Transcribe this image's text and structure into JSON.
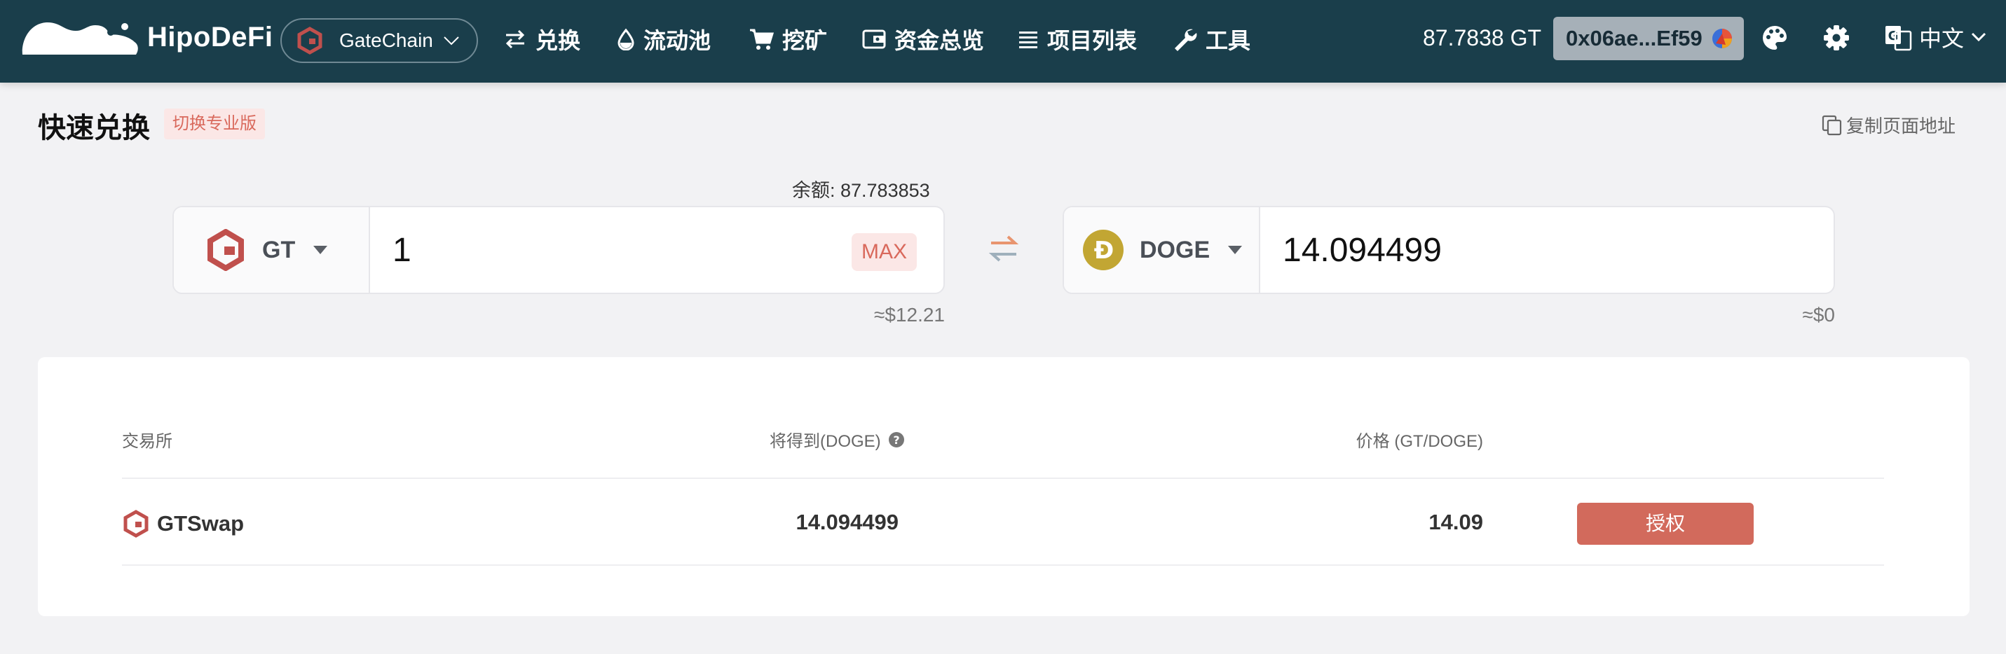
{
  "brand": {
    "name": "HipoDeFi"
  },
  "chain": {
    "name": "GateChain"
  },
  "nav": [
    {
      "label": "兑换",
      "icon": "swap-arrows-icon"
    },
    {
      "label": "流动池",
      "icon": "droplet-icon"
    },
    {
      "label": "挖矿",
      "icon": "cart-icon"
    },
    {
      "label": "资金总览",
      "icon": "wallet-icon"
    },
    {
      "label": "项目列表",
      "icon": "list-icon"
    },
    {
      "label": "工具",
      "icon": "wrench-icon"
    }
  ],
  "account": {
    "balance": "87.7838 GT",
    "address": "0x06ae...Ef59"
  },
  "language": {
    "label": "中文"
  },
  "page": {
    "title": "快速兑换",
    "pro_switch": "切换专业版",
    "copy_link": "复制页面地址"
  },
  "swap": {
    "balance_label": "余额: 87.783853",
    "from": {
      "symbol": "GT",
      "amount": "1",
      "usd": "≈$12.21",
      "max_label": "MAX"
    },
    "to": {
      "symbol": "DOGE",
      "amount": "14.094499",
      "usd": "≈$0"
    }
  },
  "quotes": {
    "headers": {
      "exchange": "交易所",
      "receive": "将得到(DOGE)",
      "price": "价格 (GT/DOGE)"
    },
    "rows": [
      {
        "exchange": "GTSwap",
        "receive": "14.094499",
        "price": "14.09",
        "action": "授权"
      }
    ]
  },
  "colors": {
    "topbar": "#1a3e4b",
    "accent": "#d26a5c",
    "gt_red": "#c0504d",
    "doge_gold": "#c2a633"
  }
}
